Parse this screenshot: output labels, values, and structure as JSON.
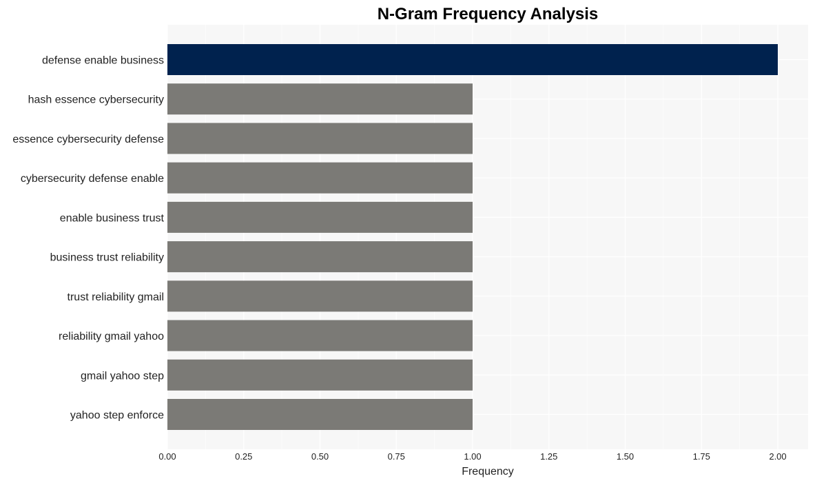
{
  "chart_data": {
    "type": "bar",
    "orientation": "horizontal",
    "title": "N-Gram Frequency Analysis",
    "xlabel": "Frequency",
    "ylabel": "",
    "xlim": [
      0,
      2.1
    ],
    "xticks": [
      0,
      0.25,
      0.5,
      0.75,
      1.0,
      1.25,
      1.5,
      1.75,
      2.0
    ],
    "xtick_labels": [
      "0.00",
      "0.25",
      "0.50",
      "0.75",
      "1.00",
      "1.25",
      "1.50",
      "1.75",
      "2.00"
    ],
    "grid": true,
    "categories": [
      "defense enable business",
      "hash essence cybersecurity",
      "essence cybersecurity defense",
      "cybersecurity defense enable",
      "enable business trust",
      "business trust reliability",
      "trust reliability gmail",
      "reliability gmail yahoo",
      "gmail yahoo step",
      "yahoo step enforce"
    ],
    "values": [
      2,
      1,
      1,
      1,
      1,
      1,
      1,
      1,
      1,
      1
    ],
    "colors": {
      "highlight": "#00224e",
      "default": "#7b7a76",
      "plot_background": "#f7f7f7",
      "grid": "#ffffff"
    }
  }
}
